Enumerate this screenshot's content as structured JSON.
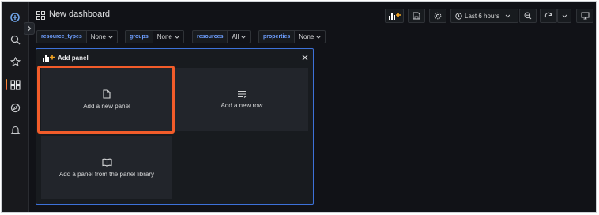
{
  "header": {
    "title": "New dashboard",
    "time_range": "Last 6 hours"
  },
  "variables": [
    {
      "label": "resource_types",
      "value": "None"
    },
    {
      "label": "groups",
      "value": "None"
    },
    {
      "label": "resources",
      "value": "All"
    },
    {
      "label": "properties",
      "value": "None"
    }
  ],
  "add_panel": {
    "title": "Add panel",
    "options": {
      "new_panel": "Add a new panel",
      "new_row": "Add a new row",
      "library": "Add a panel from the panel library"
    }
  },
  "colors": {
    "accent_blue": "#3d71d9",
    "highlight": "#f25c2a",
    "variable_label": "#6e9fff"
  },
  "icons": {
    "rail": [
      "app-logo-icon",
      "search-icon",
      "star-icon",
      "dashboards-icon",
      "explore-icon",
      "bell-icon"
    ],
    "toolbar": [
      "add-panel-icon",
      "save-icon",
      "gear-icon",
      "clock-icon",
      "zoom-out-icon",
      "refresh-icon",
      "tv-mode-icon"
    ]
  }
}
